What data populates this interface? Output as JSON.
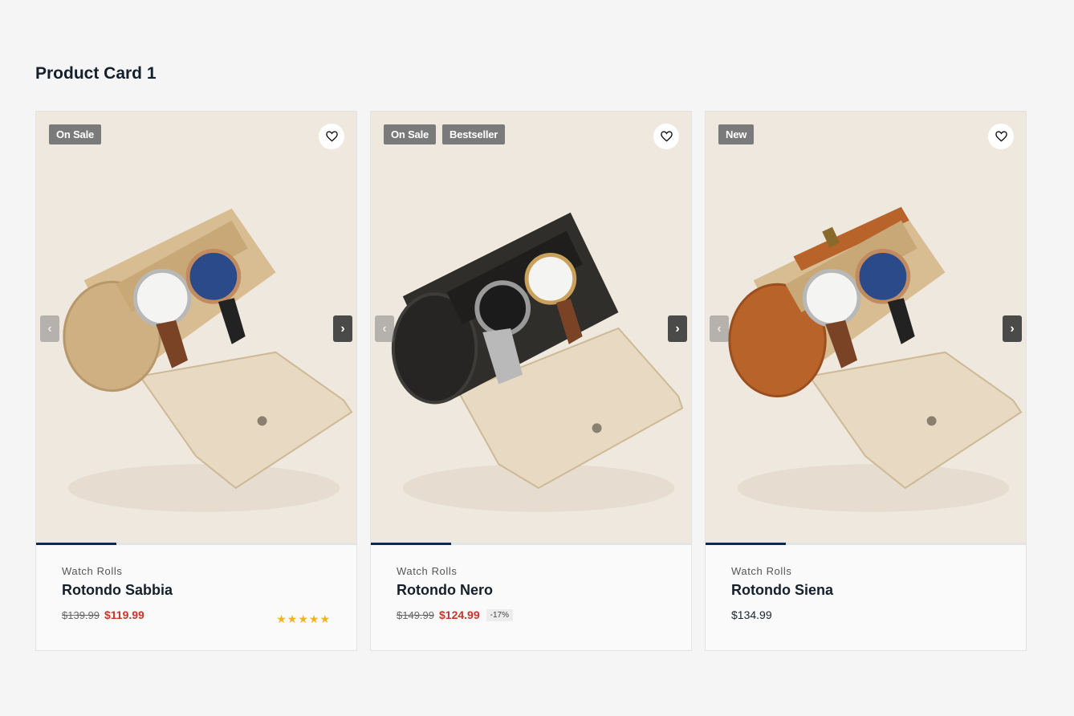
{
  "section": {
    "title": "Product Card 1"
  },
  "icons": {
    "wishlist": "heart-icon",
    "prev": "chevron-left-icon",
    "next": "chevron-right-icon",
    "rating": "star-icon"
  },
  "colors": {
    "accent": "#0d2a4a",
    "sale": "#c0392b",
    "rating": "#f5b21b",
    "badge": "#7a7a7a"
  },
  "nav_labels": {
    "prev": "‹",
    "next": "›"
  },
  "cards": [
    {
      "badges": [
        "On Sale"
      ],
      "category": "Watch Rolls",
      "name": "Rotondo Sabbia",
      "old_price": "$139.99",
      "sale_price": "$119.99",
      "rating": 5,
      "rating_text": "★★★★★",
      "slide_progress": 0.25,
      "case_color": "#d2b48a",
      "watches": [
        "silver-white-dial-brown-strap",
        "rose-gold-blue-dial-black-strap"
      ]
    },
    {
      "badges": [
        "On Sale",
        "Bestseller"
      ],
      "category": "Watch Rolls",
      "name": "Rotondo Nero",
      "old_price": "$149.99",
      "sale_price": "$124.99",
      "discount": "-17%",
      "slide_progress": 0.25,
      "case_color": "#2e2e2c",
      "watches": [
        "steel-diver-black-dial-bracelet",
        "gold-white-dial-brown-strap"
      ]
    },
    {
      "badges": [
        "New"
      ],
      "category": "Watch Rolls",
      "name": "Rotondo Siena",
      "price": "$134.99",
      "slide_progress": 0.25,
      "case_color": "#b8632a",
      "watches": [
        "silver-white-dial-brown-strap",
        "rose-gold-blue-dial-black-strap"
      ]
    }
  ]
}
